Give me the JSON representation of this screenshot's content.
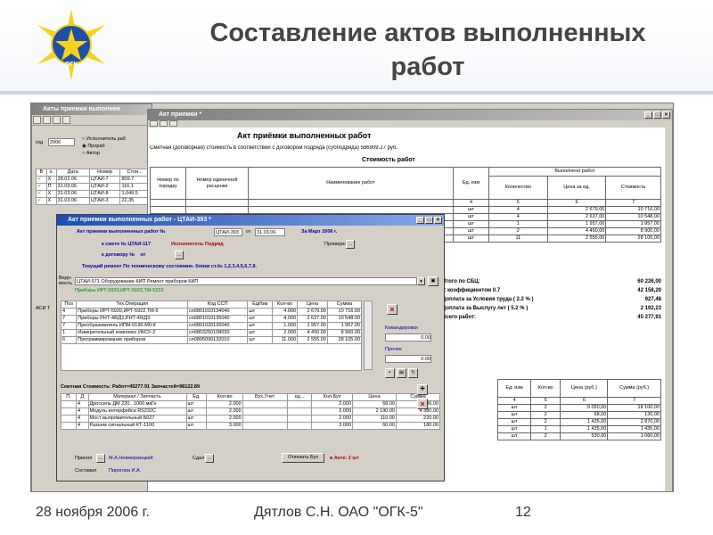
{
  "slide": {
    "title_line1": "Составление актов выполненных",
    "title_line2": "работ",
    "footer_date": "28 ноября 2006 г.",
    "footer_author": "Дятлов С.Н. ОАО \"ОГК-5\"",
    "footer_page": "12",
    "logo_text": "ОГК"
  },
  "back_window": {
    "title": "Акты приемки выполнен",
    "year_label": "год",
    "year_value": "2006",
    "radio1": "Исполнитель раб",
    "radio2": "Прораб",
    "radio3": "Автор",
    "cols": [
      "В",
      "х.",
      "Дата",
      "Номер",
      "Стои..."
    ],
    "rows": [
      [
        "✓",
        "Х",
        "28.02.06",
        "ЦТАИ-7",
        "809.7"
      ],
      [
        "✓",
        "П",
        "31.03.06",
        "ЦТАИ-2",
        "116.1"
      ],
      [
        "✓",
        "Х",
        "31.03.06",
        "ЦТАИ-8",
        "1,049.5"
      ],
      [
        "✓",
        "Х",
        "31.03.06",
        "ЦТАИ-3",
        "22,35"
      ]
    ],
    "side_label": "АСИ Т"
  },
  "act_window": {
    "title": "Акт приемки *",
    "doc_title": "Акт приёмки выполненных работ",
    "contract_text": "Сметная (договорная) стоимость в соответствии с договором подряда (субподряда)",
    "contract_value": "586909.27 руб.",
    "cost_header": "Стоимость работ",
    "head": {
      "col1": "Номер по порядку",
      "col2": "Номер единичной расценки",
      "col3": "Наименование работ",
      "col4": "Ед. изм",
      "col5": "Выполнено работ",
      "col5a": "Количество",
      "col5b": "Цена за ед.",
      "col5c": "Стоимость",
      "rub": "(руб.)",
      "n4": "4",
      "n5": "5",
      "n6": "6",
      "n7": "7"
    },
    "rows": [
      [
        "шт",
        "4",
        "2 679,00",
        "10 716,00"
      ],
      [
        "шт",
        "4",
        "2 637,00",
        "10 548,00"
      ],
      [
        "шт",
        "1",
        "1 957,00",
        "1 957,00"
      ],
      [
        "шт",
        "2",
        "4 450,00",
        "8 900,00"
      ],
      [
        "шт",
        "11",
        "2 555,00",
        "28 105,00"
      ]
    ],
    "totals": [
      [
        "Итого по СБЦ:",
        "60 226,00"
      ],
      [
        "С коэффициентом 0.7",
        "42 158,20"
      ],
      [
        "Доплата за Условия труда ( 2.2 % )",
        "927,48"
      ],
      [
        "Доплата за Выслугу лет ( 5.2 % )",
        "2 192,23"
      ],
      [
        "Всего работ:",
        "45 277,91"
      ]
    ],
    "mat_head": [
      "Ед. изм",
      "Кол-во",
      "Цена (руб.)",
      "Сумма (руб.)"
    ],
    "mat_nums": [
      "4",
      "5",
      "6",
      "7"
    ],
    "mat_rows": [
      [
        "шт",
        "2",
        "9 050,00",
        "18 100,00"
      ],
      [
        "шт",
        "2",
        "68,00",
        "136,00"
      ],
      [
        "шт",
        "2",
        "1 435,00",
        "2 870,00"
      ],
      [
        "шт",
        "1",
        "1 435,00",
        "1 435,00"
      ],
      [
        "шт",
        "2",
        "530,00",
        "1 060,00"
      ]
    ]
  },
  "form": {
    "title": "Акт приемки выполненных работ - ЦТАИ-393 *",
    "act_label": "Акт приемки выполненных работ №",
    "act_number": "ЦТАИ-393",
    "from_label": "от",
    "date": "31.03.06",
    "period": "За Март 2006 г.",
    "smeta_label": "к смете №",
    "smeta_value": "ЦТАИ-117",
    "executor_label": "Исполнитель",
    "executor_value": "Подряд",
    "checked_label": "Проверил",
    "contract_label": "к договору №",
    "contract_value": "от",
    "repair_text": "Текущий ремонт По техническому состоянию. блоки ст.№ 1,2,3,4,5,6,7,8.",
    "vedom_label": "Ведо-мость",
    "vedom_value": "ЦТАИ-571 Оборудование КИП Ремонт приборов КИП",
    "devices_text": "Приборы ИРТ-5920,ИРТ-5922,ТМ-5233",
    "grid_head": [
      "Поз",
      "Тех.Операция",
      "Код ССП",
      "ЕдИзм",
      "Кол-во",
      "Цена",
      "Сумма"
    ],
    "grid_rows": [
      [
        "4",
        "Приборы ИРТ-5920,ИРТ-5922,ТМ-5",
        "сп0801010134040",
        "шт",
        "4.000",
        "2 679.00",
        "10 716.00"
      ],
      [
        "7",
        "Приборы РНТ-48/Д1,РНТ-49/Д3",
        "сп0801010135040",
        "шт",
        "4.000",
        "2 637.00",
        "10 548.00"
      ],
      [
        "7",
        "Преобразователь ИПМ-0196-М0-К",
        "сп0801020126040",
        "шт",
        "1.000",
        "1 957.00",
        "1 957.00"
      ],
      [
        "1",
        "Измерительный комплекс ИКСУ-2",
        "сп0803250108030",
        "шт",
        "2.000",
        "4 450.00",
        "8 900.00"
      ],
      [
        "6",
        "Программирование приборов",
        "сп0805090132010",
        "шт",
        "11.000",
        "2 555.00",
        "28 105.00"
      ]
    ],
    "komandirovki_label": "Командировки",
    "komandirovki_value": "0.00",
    "prochee_label": "Прочее",
    "prochee_value": "0.00",
    "smeta_cost": "Сметная Стоимость: Работ=45277.91 Запчастей=98122.89",
    "mat_head": [
      "П.",
      "Д",
      "Материал / Запчасть",
      "Ед.",
      "Кол-во",
      "Бух.Учет",
      "ед...",
      "Кол.Бух",
      "Цена",
      "Сумма"
    ],
    "mat_rows": [
      [
        "4",
        "Дроссель ДМ 220...1000 мкГн",
        "шт",
        "2.000",
        "2.000",
        "68.00",
        "136.00"
      ],
      [
        "4",
        "Модуль интерфейса RS232C",
        "шт",
        "2.000",
        "2.000",
        "2 190.00",
        "4 380.00"
      ],
      [
        "4",
        "Мост выпрямительный Б027",
        "шт",
        "2.000",
        "2.000",
        "110.00",
        "220.00"
      ],
      [
        "4",
        "Разъем сигнальный КТ-1100",
        "шт",
        "3.000",
        "3.000",
        "60.00",
        "180.00"
      ]
    ],
    "accepted_label": "Принял",
    "accepted_value": "М.А.Невмержицкий",
    "passed_label": "Сдал",
    "compiled_label": "Составил",
    "compiled_value": "Пирогова И.А.",
    "send_btn": "Отвязать Бух",
    "in_act": "в Акте: 2 шт"
  }
}
